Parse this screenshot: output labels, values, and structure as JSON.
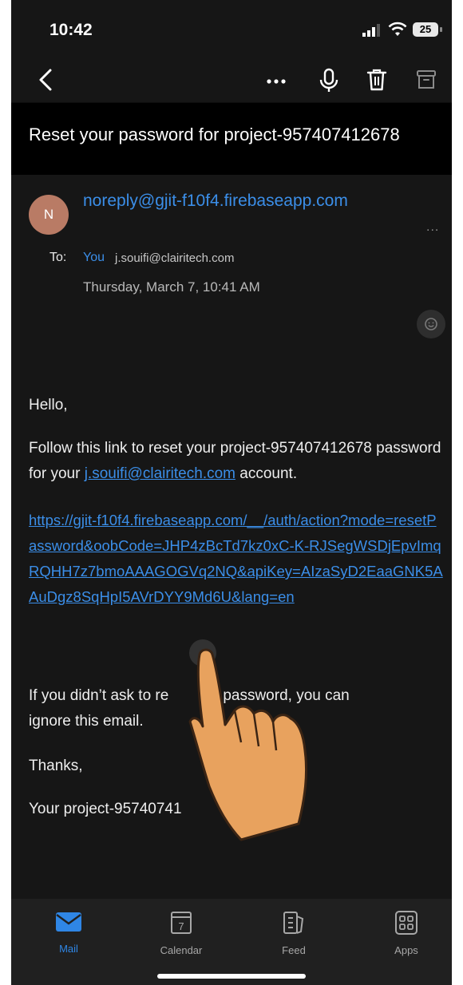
{
  "status_bar": {
    "time": "10:42",
    "battery": "25"
  },
  "toolbar": {
    "back_icon": "chevron-left-icon",
    "more_icon": "ellipsis-icon",
    "mic_icon": "microphone-icon",
    "delete_icon": "trash-icon",
    "archive_icon": "archive-icon"
  },
  "email": {
    "subject": "Reset your password for project-957407412678",
    "sender_initial": "N",
    "sender": "noreply@gjit-f10f4.firebaseapp.com",
    "header_more": "...",
    "to_label": "To:",
    "to_you": "You",
    "to_address": "j.souifi@clairitech.com",
    "date": "Thursday, March 7, 10:41 AM",
    "body": {
      "greeting": "Hello,",
      "para1_a": "Follow this link to reset your project-957407412678 password for your ",
      "para1_link": "j.souifi@clairitech.com",
      "para1_b": " account.",
      "reset_url": "https://gjit-f10f4.firebaseapp.com/__/auth/action?mode=resetPassword&oobCode=JHP4zBcTd7kz0xC-K-RJSegWSDjEpvImqRQHH7z7bmoAAAGOGVq2NQ&apiKey=AIzaSyD2EaaGNK5AAuDgz8SqHpI5AVrDYY9Md6U&lang=en",
      "para2_a": "If you didn’t ask to re",
      "para2_b": "password, you can",
      "para2_c": "ignore this email.",
      "thanks": "Thanks,",
      "signature": "Your project-95740741"
    }
  },
  "tabs": [
    {
      "label": "Mail",
      "icon": "mail-icon",
      "active": true
    },
    {
      "label": "Calendar",
      "icon": "calendar-icon",
      "badge": "7",
      "active": false
    },
    {
      "label": "Feed",
      "icon": "feed-icon",
      "active": false
    },
    {
      "label": "Apps",
      "icon": "apps-icon",
      "active": false
    }
  ],
  "colors": {
    "accent": "#3b8ee8",
    "background": "#161616",
    "subject_bar": "#000000",
    "avatar": "#b97b65"
  }
}
